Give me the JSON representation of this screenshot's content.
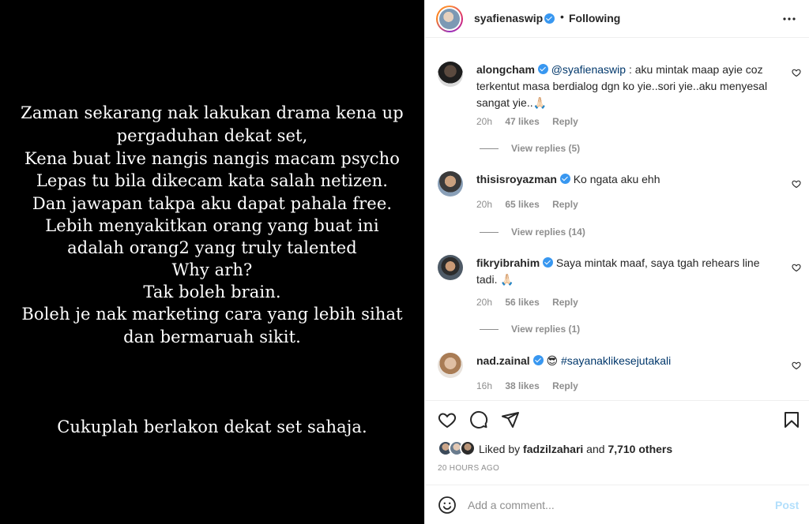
{
  "post_image": {
    "lines": [
      "Zaman sekarang nak lakukan drama kena up",
      "pergaduhan dekat set,",
      "Kena buat live nangis nangis macam psycho",
      "Lepas tu bila dikecam kata salah netizen.",
      "Dan jawapan takpa aku dapat pahala free.",
      "Lebih menyakitkan orang yang buat ini",
      "adalah orang2 yang truly talented",
      "Why arh?",
      "Tak boleh brain.",
      "Boleh je nak marketing cara yang lebih sihat",
      "dan bermaruah sikit.",
      "Cukuplah berlakon dekat set sahaja."
    ]
  },
  "header": {
    "username": "syafienaswip",
    "separator": "•",
    "follow_status": "Following",
    "more_icon": "more-horizontal-icon"
  },
  "comments": [
    {
      "username": "alongcham",
      "mention": "@syafienaswip",
      "text": " : aku mintak maap ayie coz terkentut masa berdialog dgn ko yie..sori yie..aku menyesal sangat yie..🙏🏻",
      "time": "20h",
      "likes": "47 likes",
      "reply": "Reply",
      "view_replies": "View replies (5)"
    },
    {
      "username": "thisisroyazman",
      "mention": "",
      "text": "Ko ngata aku ehh",
      "time": "20h",
      "likes": "65 likes",
      "reply": "Reply",
      "view_replies": "View replies (14)"
    },
    {
      "username": "fikryibrahim",
      "mention": "",
      "text": "Saya mintak maaf, saya tgah rehears line tadi. 🙏🏻",
      "time": "20h",
      "likes": "56 likes",
      "reply": "Reply",
      "view_replies": "View replies (1)"
    },
    {
      "username": "nad.zainal",
      "emoji": "😎",
      "hashtag": "#sayanaklikesejutakali",
      "time": "16h",
      "likes": "38 likes",
      "reply": "Reply"
    }
  ],
  "actions": {
    "like_icon": "heart-icon",
    "comment_icon": "comment-icon",
    "share_icon": "send-icon",
    "save_icon": "bookmark-icon"
  },
  "liked_by": {
    "prefix": "Liked by ",
    "user": "fadzilzahari",
    "middle": " and ",
    "others": "7,710 others"
  },
  "timestamp": "20 HOURS AGO",
  "add_comment": {
    "placeholder": "Add a comment...",
    "post_label": "Post"
  },
  "colors": {
    "verified": "#3897f0",
    "link": "#00376b",
    "muted": "#8e8e8e",
    "post_disabled": "#b2dffc"
  }
}
